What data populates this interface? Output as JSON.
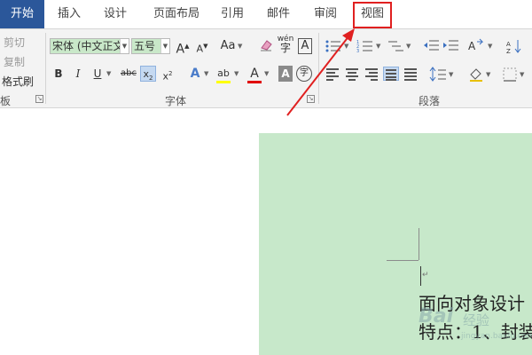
{
  "tabs": [
    {
      "label": "开始",
      "active": true
    },
    {
      "label": "插入"
    },
    {
      "label": "设计"
    },
    {
      "label": "页面布局"
    },
    {
      "label": "引用"
    },
    {
      "label": "邮件"
    },
    {
      "label": "审阅"
    },
    {
      "label": "视图",
      "highlighted": true
    }
  ],
  "clipboard": {
    "cut_label": "剪切",
    "copy_label": "复制",
    "format_painter_label": "格式刷",
    "group_label": "板"
  },
  "font": {
    "font_name": "宋体 (中文正文)",
    "font_size": "五号",
    "grow_label": "A",
    "shrink_label": "A",
    "change_case_label": "Aa",
    "phonetic_label": "wén",
    "border_label": "A",
    "bold_label": "B",
    "italic_label": "I",
    "underline_label": "U",
    "strike_label": "abc",
    "subscript_label": "x",
    "subscript_suffix": "2",
    "superscript_label": "x",
    "superscript_suffix": "2",
    "effects_label": "A",
    "highlight_label": "ab",
    "color_label": "A",
    "shading_label": "A",
    "enclose_label": "字",
    "group_label": "字体"
  },
  "paragraph": {
    "group_label": "段落"
  },
  "colors": {
    "tab_active_bg": "#2b579a",
    "highlight_box": "#e02020",
    "page_bg": "#c7e8ca",
    "font_color_bar": "#e00000",
    "highlight_bar": "#ffff00"
  },
  "document": {
    "line1": "面向对象设计",
    "line2": "特点：1、封装"
  },
  "watermark": {
    "brand": "Bai",
    "brand_suffix": "经验",
    "domain": "jingyan.baidu.com"
  }
}
